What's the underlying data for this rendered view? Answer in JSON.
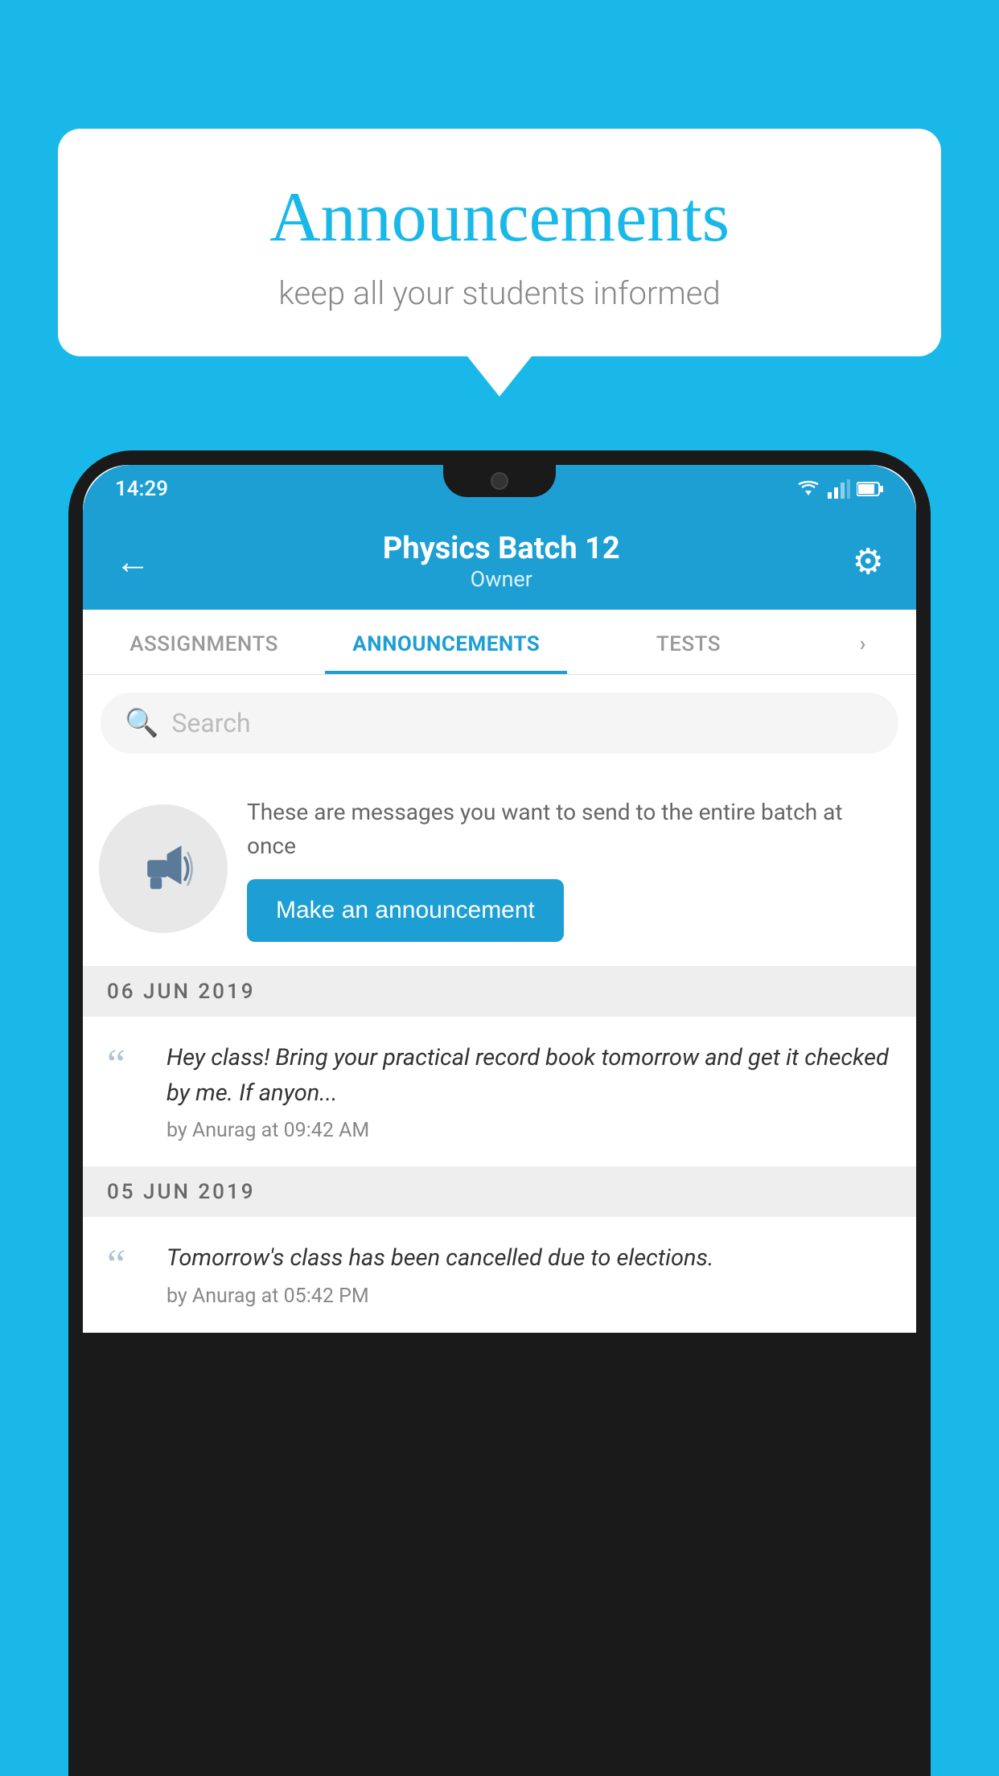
{
  "background_color": "#1ab8e8",
  "speech_bubble": {
    "title": "Announcements",
    "subtitle": "keep all your students informed"
  },
  "phone": {
    "status_bar": {
      "time": "14:29"
    },
    "header": {
      "title": "Physics Batch 12",
      "subtitle": "Owner",
      "back_label": "←",
      "settings_label": "⚙"
    },
    "tabs": [
      {
        "label": "ASSIGNMENTS",
        "active": false
      },
      {
        "label": "ANNOUNCEMENTS",
        "active": true
      },
      {
        "label": "TESTS",
        "active": false
      },
      {
        "label": "···",
        "active": false
      }
    ],
    "search": {
      "placeholder": "Search"
    },
    "promo": {
      "description": "These are messages you want to send to the entire batch at once",
      "button_label": "Make an announcement"
    },
    "announcements": [
      {
        "date": "06  JUN  2019",
        "message": "Hey class! Bring your practical record book tomorrow and get it checked by me. If anyon...",
        "author": "by Anurag at 09:42 AM"
      },
      {
        "date": "05  JUN  2019",
        "message": "Tomorrow's class has been cancelled due to elections.",
        "author": "by Anurag at 05:42 PM"
      }
    ]
  }
}
